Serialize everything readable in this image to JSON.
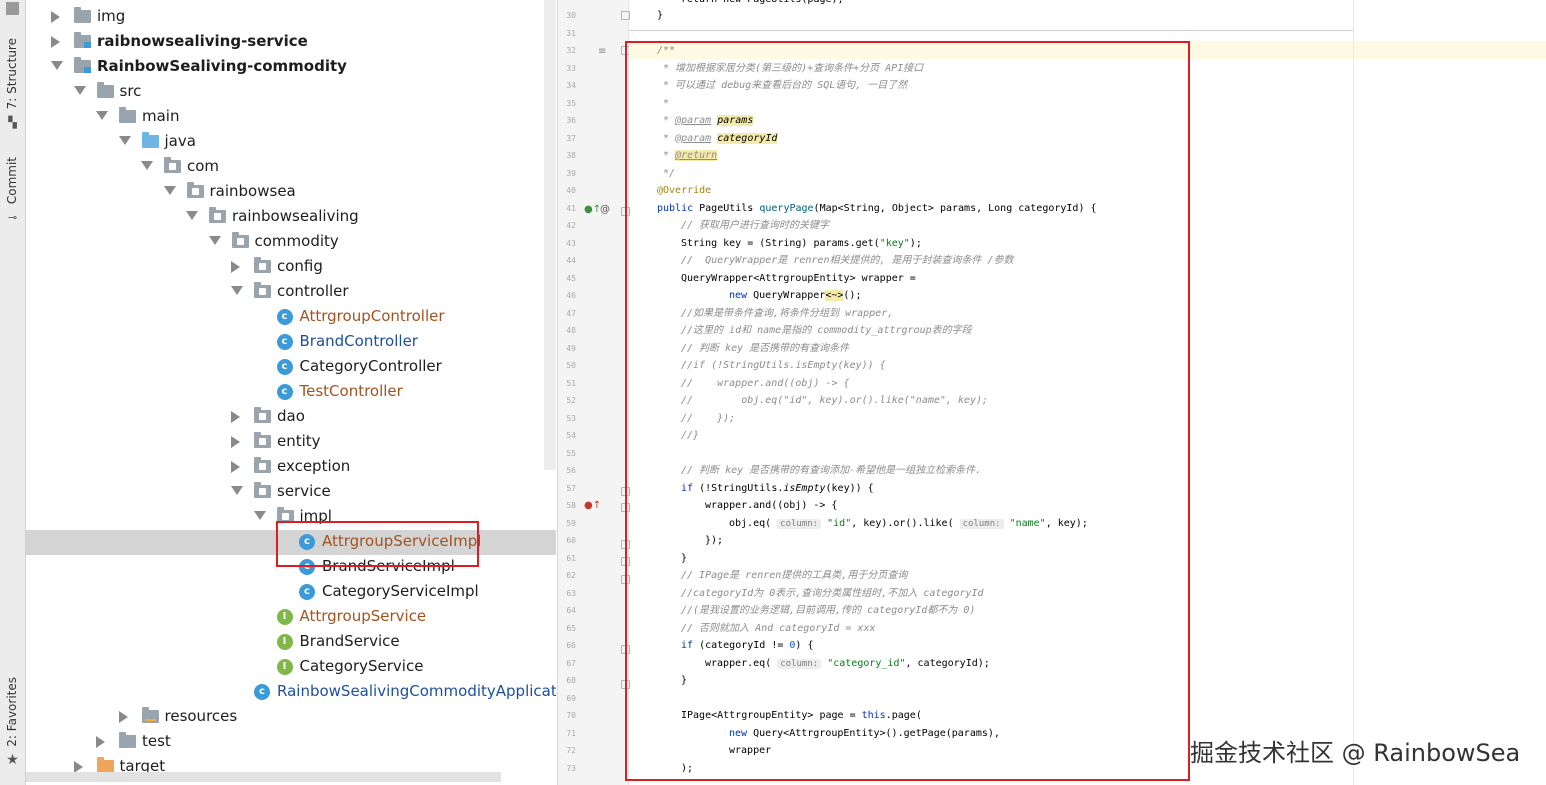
{
  "sidebar_tabs": {
    "structure": "7: Structure",
    "commit": "Commit",
    "favorites": "2: Favorites"
  },
  "tree": [
    {
      "label": "img",
      "kind": "folder",
      "depth": 1,
      "arrow": "right",
      "style": "normal"
    },
    {
      "label": "raibnowsealiving-service",
      "kind": "module",
      "depth": 1,
      "arrow": "right",
      "style": "bold"
    },
    {
      "label": "RainbowSealiving-commodity",
      "kind": "module",
      "depth": 1,
      "arrow": "down",
      "style": "bold"
    },
    {
      "label": "src",
      "kind": "folder",
      "depth": 2,
      "arrow": "down",
      "style": "normal"
    },
    {
      "label": "main",
      "kind": "folder",
      "depth": 3,
      "arrow": "down",
      "style": "normal"
    },
    {
      "label": "java",
      "kind": "src-folder",
      "depth": 4,
      "arrow": "down",
      "style": "normal"
    },
    {
      "label": "com",
      "kind": "package",
      "depth": 5,
      "arrow": "down",
      "style": "normal"
    },
    {
      "label": "rainbowsea",
      "kind": "package",
      "depth": 6,
      "arrow": "down",
      "style": "normal"
    },
    {
      "label": "rainbowsealiving",
      "kind": "package",
      "depth": 7,
      "arrow": "down",
      "style": "normal"
    },
    {
      "label": "commodity",
      "kind": "package",
      "depth": 8,
      "arrow": "down",
      "style": "normal"
    },
    {
      "label": "config",
      "kind": "package",
      "depth": 9,
      "arrow": "right",
      "style": "normal"
    },
    {
      "label": "controller",
      "kind": "package",
      "depth": 9,
      "arrow": "down",
      "style": "normal"
    },
    {
      "label": "AttrgroupController",
      "kind": "class",
      "depth": 10,
      "arrow": "",
      "style": "orange"
    },
    {
      "label": "BrandController",
      "kind": "class",
      "depth": 10,
      "arrow": "",
      "style": "blue"
    },
    {
      "label": "CategoryController",
      "kind": "class",
      "depth": 10,
      "arrow": "",
      "style": "normal"
    },
    {
      "label": "TestController",
      "kind": "class",
      "depth": 10,
      "arrow": "",
      "style": "orange"
    },
    {
      "label": "dao",
      "kind": "package",
      "depth": 9,
      "arrow": "right",
      "style": "normal"
    },
    {
      "label": "entity",
      "kind": "package",
      "depth": 9,
      "arrow": "right",
      "style": "normal"
    },
    {
      "label": "exception",
      "kind": "package",
      "depth": 9,
      "arrow": "right",
      "style": "normal"
    },
    {
      "label": "service",
      "kind": "package",
      "depth": 9,
      "arrow": "down",
      "style": "normal"
    },
    {
      "label": "impl",
      "kind": "package",
      "depth": 10,
      "arrow": "down",
      "style": "normal"
    },
    {
      "label": "AttrgroupServiceImpl",
      "kind": "class",
      "depth": 11,
      "arrow": "",
      "style": "orange",
      "selected": true
    },
    {
      "label": "BrandServiceImpl",
      "kind": "class",
      "depth": 11,
      "arrow": "",
      "style": "normal"
    },
    {
      "label": "CategoryServiceImpl",
      "kind": "class",
      "depth": 11,
      "arrow": "",
      "style": "normal"
    },
    {
      "label": "AttrgroupService",
      "kind": "interface",
      "depth": 10,
      "arrow": "",
      "style": "orange"
    },
    {
      "label": "BrandService",
      "kind": "interface",
      "depth": 10,
      "arrow": "",
      "style": "normal"
    },
    {
      "label": "CategoryService",
      "kind": "interface",
      "depth": 10,
      "arrow": "",
      "style": "normal"
    },
    {
      "label": "RainbowSealivingCommodityApplicati",
      "kind": "app",
      "depth": 9,
      "arrow": "",
      "style": "blue"
    },
    {
      "label": "resources",
      "kind": "res-folder",
      "depth": 4,
      "arrow": "right",
      "style": "normal"
    },
    {
      "label": "test",
      "kind": "folder",
      "depth": 3,
      "arrow": "right",
      "style": "normal"
    },
    {
      "label": "target",
      "kind": "target-folder",
      "depth": 2,
      "arrow": "right",
      "style": "normal"
    }
  ],
  "code": {
    "first_line_number": 30,
    "lines": [
      {
        "n": 30,
        "html": "}",
        "indent": 0
      },
      {
        "n": 31,
        "html": "",
        "indent": 0
      },
      {
        "n": 32,
        "html": "<span class='cmt'>/**</span>",
        "indent": 0
      },
      {
        "n": 33,
        "html": "<span class='cmt'> * 增加根据家居分类(第三级的)+查询条件+分页 API接口</span>",
        "indent": 0
      },
      {
        "n": 34,
        "html": "<span class='cmt'> * 可以通过 debug来查看后台的 SQL语句, 一目了然</span>",
        "indent": 0
      },
      {
        "n": 35,
        "html": "<span class='cmt'> *</span>",
        "indent": 0
      },
      {
        "n": 36,
        "html": "<span class='cmt'> * </span><span class='tag'>@param</span><span class='cmt'> </span><span class='par'>params</span>",
        "indent": 0
      },
      {
        "n": 37,
        "html": "<span class='cmt'> * </span><span class='tag'>@param</span><span class='cmt'> </span><span class='par'>categoryId</span>",
        "indent": 0
      },
      {
        "n": 38,
        "html": "<span class='cmt'> * </span><span class='tag' style='background:#f5eaa8'>@return</span>",
        "indent": 0
      },
      {
        "n": 39,
        "html": "<span class='cmt'> */</span>",
        "indent": 0
      },
      {
        "n": 40,
        "html": "<span class='ann'>@Override</span>",
        "indent": 0
      },
      {
        "n": 41,
        "html": "<span class='kw'>public</span> PageUtils <span class='fn'>queryPage</span>(Map&lt;String, Object&gt; params, Long categoryId) {",
        "indent": 0
      },
      {
        "n": 42,
        "html": "<span class='cmt'>// 获取用户进行查询时的关键字</span>",
        "indent": 1
      },
      {
        "n": 43,
        "html": "String key = (String) params.get(<span class='str'>\"key\"</span>);",
        "indent": 1
      },
      {
        "n": 44,
        "html": "<span class='cmt'>//  QueryWrapper是 renren相关提供的, 是用于封装查询条件 /参数</span>",
        "indent": 1
      },
      {
        "n": 45,
        "html": "QueryWrapper&lt;AttrgroupEntity&gt; wrapper =",
        "indent": 1
      },
      {
        "n": 46,
        "html": "<span class='kw'>new</span> QueryWrapper<span class='par' style='font-style:normal'>&lt;~&gt;</span>();",
        "indent": 3
      },
      {
        "n": 47,
        "html": "<span class='cmt'>//如果是带条件查询,将条件分组到 wrapper,</span>",
        "indent": 1
      },
      {
        "n": 48,
        "html": "<span class='cmt'>//这里的 id和 name是指的 commodity_attrgroup表的字段</span>",
        "indent": 1
      },
      {
        "n": 49,
        "html": "<span class='cmt'>// 判断 key 是否携带的有查询条件</span>",
        "indent": 1
      },
      {
        "n": 50,
        "html": "<span class='cmt'>//if (!StringUtils.isEmpty(key)) {</span>",
        "indent": 1
      },
      {
        "n": 51,
        "html": "<span class='cmt'>//    wrapper.and((obj) -&gt; {</span>",
        "indent": 1
      },
      {
        "n": 52,
        "html": "<span class='cmt'>//        obj.eq(\"id\", key).or().like(\"name\", key);</span>",
        "indent": 1
      },
      {
        "n": 53,
        "html": "<span class='cmt'>//    });</span>",
        "indent": 1
      },
      {
        "n": 54,
        "html": "<span class='cmt'>//}</span>",
        "indent": 1
      },
      {
        "n": 55,
        "html": "",
        "indent": 0
      },
      {
        "n": 56,
        "html": "<span class='cmt'>// 判断 key 是否携带的有查询添加-希望他是一组独立检索条件.</span>",
        "indent": 1
      },
      {
        "n": 57,
        "html": "<span class='kw'>if</span> (!StringUtils.<span style='font-style:italic'>isEmpty</span>(key)) {",
        "indent": 1
      },
      {
        "n": 58,
        "html": "wrapper.and((obj) -&gt; {",
        "indent": 2
      },
      {
        "n": 59,
        "html": "obj.eq( <span class='hint'>column:</span> <span class='str'>\"id\"</span>, key).or().like( <span class='hint'>column:</span> <span class='str'>\"name\"</span>, key);",
        "indent": 3
      },
      {
        "n": 60,
        "html": "});",
        "indent": 2
      },
      {
        "n": 61,
        "html": "}",
        "indent": 1
      },
      {
        "n": 62,
        "html": "<span class='cmt'>// IPage是 renren提供的工具类,用于分页查询</span>",
        "indent": 1
      },
      {
        "n": 63,
        "html": "<span class='cmt'>//categoryId为 0表示,查询分类属性组时,不加入 categoryId</span>",
        "indent": 1
      },
      {
        "n": 64,
        "html": "<span class='cmt'>//(是我设置的业务逻辑,目前调用,传的 categoryId都不为 0)</span>",
        "indent": 1
      },
      {
        "n": 65,
        "html": "<span class='cmt'>// 否则就加入 And categoryId = xxx</span>",
        "indent": 1
      },
      {
        "n": 66,
        "html": "<span class='kw'>if</span> (categoryId != <span class='num'>0</span>) {",
        "indent": 1
      },
      {
        "n": 67,
        "html": "wrapper.eq( <span class='hint'>column:</span> <span class='str'>\"category_id\"</span>, categoryId);",
        "indent": 2
      },
      {
        "n": 68,
        "html": "}",
        "indent": 1
      },
      {
        "n": 69,
        "html": "",
        "indent": 0
      },
      {
        "n": 70,
        "html": "IPage&lt;AttrgroupEntity&gt; page = <span class='kw'>this</span>.page(",
        "indent": 1
      },
      {
        "n": 71,
        "html": "<span class='kw'>new</span> Query&lt;AttrgroupEntity&gt;().getPage(params),",
        "indent": 3
      },
      {
        "n": 72,
        "html": "wrapper",
        "indent": 3
      },
      {
        "n": 73,
        "html": ");",
        "indent": 1
      }
    ]
  },
  "top_partial_line": "return new PageUtils(page);",
  "watermark": "掘金技术社区 @ RainbowSea",
  "colors": {
    "highlight_box": "#d91f26",
    "selected_row": "#d4d4d4"
  }
}
